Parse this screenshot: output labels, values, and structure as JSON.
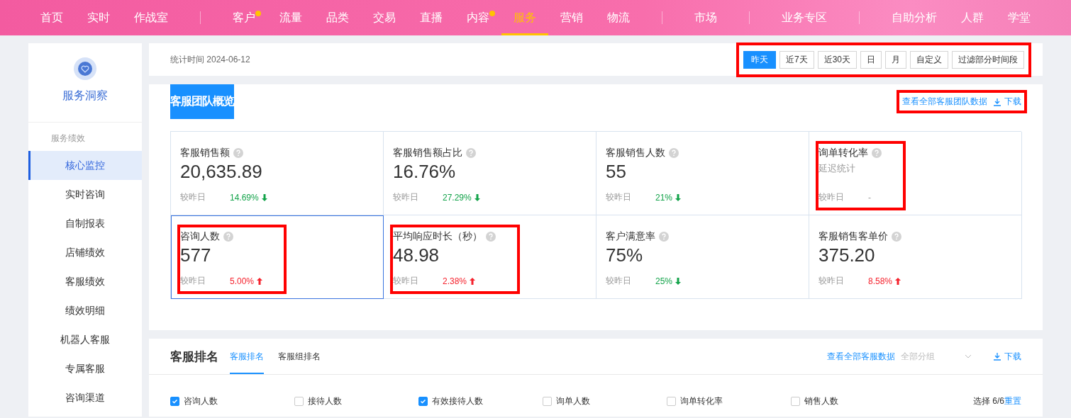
{
  "nav": {
    "groups": [
      {
        "items": [
          {
            "label": "首页",
            "selected": false,
            "dot": false
          },
          {
            "label": "实时",
            "selected": false,
            "dot": false
          },
          {
            "label": "作战室",
            "selected": false,
            "dot": false
          }
        ]
      },
      {
        "items": [
          {
            "label": "客户",
            "selected": false,
            "dot": true
          },
          {
            "label": "流量",
            "selected": false,
            "dot": false
          },
          {
            "label": "品类",
            "selected": false,
            "dot": false
          },
          {
            "label": "交易",
            "selected": false,
            "dot": false
          },
          {
            "label": "直播",
            "selected": false,
            "dot": false
          },
          {
            "label": "内容",
            "selected": false,
            "dot": true
          },
          {
            "label": "服务",
            "selected": true,
            "dot": false
          },
          {
            "label": "营销",
            "selected": false,
            "dot": false
          },
          {
            "label": "物流",
            "selected": false,
            "dot": false
          }
        ]
      },
      {
        "items": [
          {
            "label": "市场",
            "selected": false,
            "dot": false
          }
        ]
      },
      {
        "items": [
          {
            "label": "业务专区",
            "selected": false,
            "dot": false
          }
        ]
      },
      {
        "items": [
          {
            "label": "自助分析",
            "selected": false,
            "dot": false
          },
          {
            "label": "人群",
            "selected": false,
            "dot": false
          },
          {
            "label": "学堂",
            "selected": false,
            "dot": false
          }
        ]
      }
    ]
  },
  "sidebar": {
    "title": "服务洞察",
    "group_label": "服务绩效",
    "items": [
      {
        "label": "核心监控",
        "selected": true
      },
      {
        "label": "实时咨询",
        "selected": false
      },
      {
        "label": "自制报表",
        "selected": false
      },
      {
        "label": "店铺绩效",
        "selected": false
      },
      {
        "label": "客服绩效",
        "selected": false
      },
      {
        "label": "绩效明细",
        "selected": false
      },
      {
        "label": "机器人客服",
        "selected": false
      },
      {
        "label": "专属客服",
        "selected": false
      },
      {
        "label": "咨询渠道",
        "selected": false
      }
    ]
  },
  "date_bar": {
    "stat_time": "统计时间 2024-06-12",
    "highlighted": true,
    "ranges": [
      {
        "label": "昨天",
        "selected": true
      },
      {
        "label": "近7天",
        "selected": false
      },
      {
        "label": "近30天",
        "selected": false
      },
      {
        "label": "日",
        "selected": false
      },
      {
        "label": "月",
        "selected": false
      },
      {
        "label": "自定义",
        "selected": false
      },
      {
        "label": "过滤部分时间段",
        "selected": false
      }
    ]
  },
  "overview": {
    "title": "客服团队概览",
    "links_highlighted": true,
    "view_all": "查看全部客服团队数据",
    "download": "下载",
    "metrics": [
      {
        "label": "客服销售额",
        "value": "20,635.89",
        "muted": false,
        "compare_label": "较昨日",
        "change": "14.69%",
        "kind": "down",
        "selected": false,
        "highlighted": false
      },
      {
        "label": "客服销售额占比",
        "value": "16.76%",
        "muted": false,
        "compare_label": "较昨日",
        "change": "27.29%",
        "kind": "down",
        "selected": false,
        "highlighted": false
      },
      {
        "label": "客服销售人数",
        "value": "55",
        "muted": false,
        "compare_label": "较昨日",
        "change": "21%",
        "kind": "down",
        "selected": false,
        "highlighted": false
      },
      {
        "label": "询单转化率",
        "value": "延迟统计",
        "muted": true,
        "compare_label": "较昨日",
        "change": "-",
        "kind": "none",
        "selected": false,
        "highlighted": true
      },
      {
        "label": "咨询人数",
        "value": "577",
        "muted": false,
        "compare_label": "较昨日",
        "change": "5.00%",
        "kind": "up",
        "selected": true,
        "highlighted": true
      },
      {
        "label": "平均响应时长（秒）",
        "value": "48.98",
        "muted": false,
        "compare_label": "较昨日",
        "change": "2.38%",
        "kind": "up",
        "selected": false,
        "highlighted": true
      },
      {
        "label": "客户满意率",
        "value": "75%",
        "muted": false,
        "compare_label": "较昨日",
        "change": "25%",
        "kind": "down",
        "selected": false,
        "highlighted": false
      },
      {
        "label": "客服销售客单价",
        "value": "375.20",
        "muted": false,
        "compare_label": "较昨日",
        "change": "8.58%",
        "kind": "up",
        "selected": false,
        "highlighted": false
      }
    ]
  },
  "ranking": {
    "title": "客服排名",
    "tabs": [
      {
        "label": "客服排名",
        "selected": true
      },
      {
        "label": "客服组排名",
        "selected": false
      }
    ],
    "view_all": "查看全部客服数据",
    "group_select": "全部分组",
    "download": "下载",
    "columns": [
      {
        "label": "咨询人数",
        "checked": true
      },
      {
        "label": "接待人数",
        "checked": false
      },
      {
        "label": "有效接待人数",
        "checked": true
      },
      {
        "label": "询单人数",
        "checked": false
      },
      {
        "label": "询单转化率",
        "checked": false
      },
      {
        "label": "销售人数",
        "checked": false
      }
    ],
    "selection": "选择 6/6",
    "reset": "重置"
  }
}
